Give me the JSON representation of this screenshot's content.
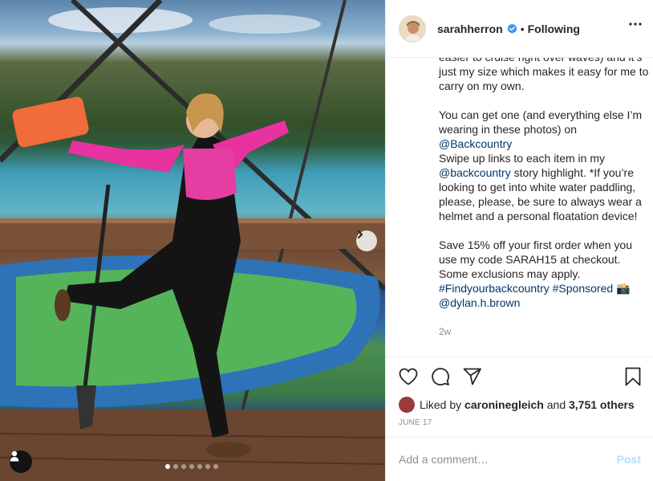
{
  "post": {
    "username": "sarahherron",
    "separator": "•",
    "following_label": "Following",
    "caption": {
      "para1_line": "easier to cruise right over waves) and it’s just my size which makes it easy for me to carry on my own.",
      "para2_text": "You can get one (and everything else I’m wearing in these photos) on",
      "mention_backcountry_1": "@Backcountry",
      "para2_swipe": "Swipe up links to each item in my",
      "mention_backcountry_2": "@backcountry",
      "para2_rest": "story highlight. *If you’re looking to get into white water paddling, please, please, be sure to always wear a helmet and a personal floatation device!",
      "para3_text": "Save 15% off your first order when you use my code SARAH15 at checkout. Some exclusions may apply.",
      "hashtag_1": "#Findyourbackcountry",
      "hashtag_2": "#Sponsored",
      "camera_emoji": "📸",
      "mention_photographer": "@dylan.h.brown",
      "time_ago": "2w"
    },
    "likes": {
      "prefix": "Liked by",
      "liker": "caroninegleich",
      "conjunction": "and",
      "others": "3,751 others"
    },
    "date": "JUNE 17",
    "comment": {
      "placeholder": "Add a comment…",
      "post_label": "Post"
    },
    "carousel": {
      "slide_count": 7,
      "active_index": 0
    }
  },
  "colors": {
    "link": "#00376b",
    "verified": "#3897f0",
    "post_disabled": "#b2dffc",
    "muted": "#8e8e8e"
  },
  "icons": [
    "next-arrow-icon",
    "user-tag-icon",
    "more-options-icon",
    "verified-badge-icon",
    "heart-icon",
    "comment-icon",
    "share-icon",
    "bookmark-icon"
  ]
}
